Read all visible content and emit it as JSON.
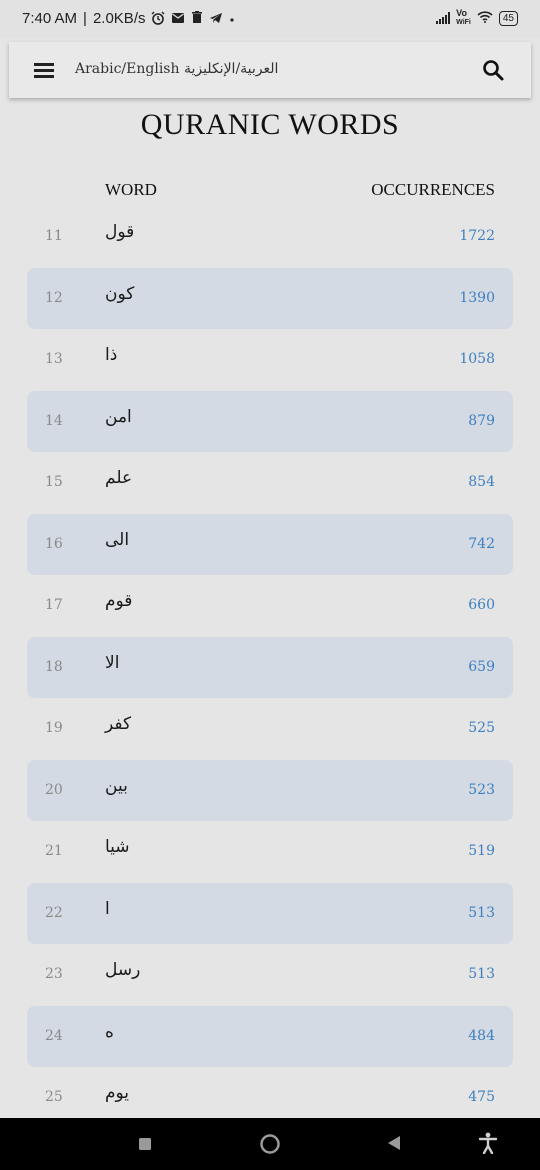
{
  "status_bar": {
    "time": "7:40 AM",
    "net_speed": "2.0KB/s",
    "separator": "|",
    "volte": "Vo",
    "wifi_label": "WiFi",
    "battery": "45"
  },
  "app_bar": {
    "language_label": "Arabic/English العربية/الإنكليزية"
  },
  "page": {
    "title": "QURANIC WORDS",
    "col_word": "WORD",
    "col_occurrences": "OCCURRENCES"
  },
  "rows": [
    {
      "rank": "11",
      "word": "قول",
      "count": "1722"
    },
    {
      "rank": "12",
      "word": "كون",
      "count": "1390"
    },
    {
      "rank": "13",
      "word": "ذا",
      "count": "1058"
    },
    {
      "rank": "14",
      "word": "امن",
      "count": "879"
    },
    {
      "rank": "15",
      "word": "علم",
      "count": "854"
    },
    {
      "rank": "16",
      "word": "الى",
      "count": "742"
    },
    {
      "rank": "17",
      "word": "قوم",
      "count": "660"
    },
    {
      "rank": "18",
      "word": "الا",
      "count": "659"
    },
    {
      "rank": "19",
      "word": "كفر",
      "count": "525"
    },
    {
      "rank": "20",
      "word": "بين",
      "count": "523"
    },
    {
      "rank": "21",
      "word": "شيا",
      "count": "519"
    },
    {
      "rank": "22",
      "word": "ا",
      "count": "513"
    },
    {
      "rank": "23",
      "word": "رسل",
      "count": "513"
    },
    {
      "rank": "24",
      "word": "ه",
      "count": "484"
    },
    {
      "rank": "25",
      "word": "يوم",
      "count": "475"
    }
  ],
  "colors": {
    "row_highlight": "#d3dae3",
    "count_blue": "#3d7fc1",
    "background": "#e5e5e5"
  }
}
